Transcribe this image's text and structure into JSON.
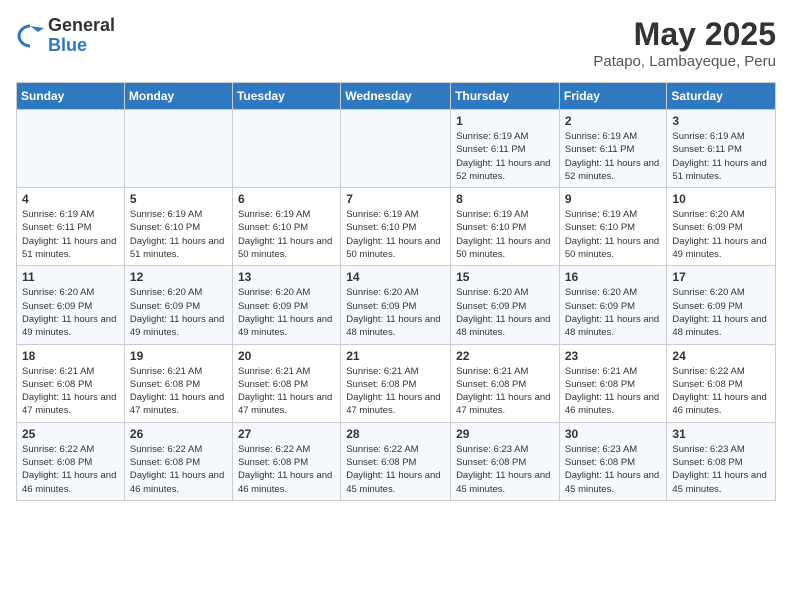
{
  "logo": {
    "general": "General",
    "blue": "Blue"
  },
  "title": "May 2025",
  "subtitle": "Patapo, Lambayeque, Peru",
  "days_of_week": [
    "Sunday",
    "Monday",
    "Tuesday",
    "Wednesday",
    "Thursday",
    "Friday",
    "Saturday"
  ],
  "weeks": [
    [
      {
        "day": "",
        "info": ""
      },
      {
        "day": "",
        "info": ""
      },
      {
        "day": "",
        "info": ""
      },
      {
        "day": "",
        "info": ""
      },
      {
        "day": "1",
        "info": "Sunrise: 6:19 AM\nSunset: 6:11 PM\nDaylight: 11 hours\nand 52 minutes."
      },
      {
        "day": "2",
        "info": "Sunrise: 6:19 AM\nSunset: 6:11 PM\nDaylight: 11 hours\nand 52 minutes."
      },
      {
        "day": "3",
        "info": "Sunrise: 6:19 AM\nSunset: 6:11 PM\nDaylight: 11 hours\nand 51 minutes."
      }
    ],
    [
      {
        "day": "4",
        "info": "Sunrise: 6:19 AM\nSunset: 6:11 PM\nDaylight: 11 hours\nand 51 minutes."
      },
      {
        "day": "5",
        "info": "Sunrise: 6:19 AM\nSunset: 6:10 PM\nDaylight: 11 hours\nand 51 minutes."
      },
      {
        "day": "6",
        "info": "Sunrise: 6:19 AM\nSunset: 6:10 PM\nDaylight: 11 hours\nand 50 minutes."
      },
      {
        "day": "7",
        "info": "Sunrise: 6:19 AM\nSunset: 6:10 PM\nDaylight: 11 hours\nand 50 minutes."
      },
      {
        "day": "8",
        "info": "Sunrise: 6:19 AM\nSunset: 6:10 PM\nDaylight: 11 hours\nand 50 minutes."
      },
      {
        "day": "9",
        "info": "Sunrise: 6:19 AM\nSunset: 6:10 PM\nDaylight: 11 hours\nand 50 minutes."
      },
      {
        "day": "10",
        "info": "Sunrise: 6:20 AM\nSunset: 6:09 PM\nDaylight: 11 hours\nand 49 minutes."
      }
    ],
    [
      {
        "day": "11",
        "info": "Sunrise: 6:20 AM\nSunset: 6:09 PM\nDaylight: 11 hours\nand 49 minutes."
      },
      {
        "day": "12",
        "info": "Sunrise: 6:20 AM\nSunset: 6:09 PM\nDaylight: 11 hours\nand 49 minutes."
      },
      {
        "day": "13",
        "info": "Sunrise: 6:20 AM\nSunset: 6:09 PM\nDaylight: 11 hours\nand 49 minutes."
      },
      {
        "day": "14",
        "info": "Sunrise: 6:20 AM\nSunset: 6:09 PM\nDaylight: 11 hours\nand 48 minutes."
      },
      {
        "day": "15",
        "info": "Sunrise: 6:20 AM\nSunset: 6:09 PM\nDaylight: 11 hours\nand 48 minutes."
      },
      {
        "day": "16",
        "info": "Sunrise: 6:20 AM\nSunset: 6:09 PM\nDaylight: 11 hours\nand 48 minutes."
      },
      {
        "day": "17",
        "info": "Sunrise: 6:20 AM\nSunset: 6:09 PM\nDaylight: 11 hours\nand 48 minutes."
      }
    ],
    [
      {
        "day": "18",
        "info": "Sunrise: 6:21 AM\nSunset: 6:08 PM\nDaylight: 11 hours\nand 47 minutes."
      },
      {
        "day": "19",
        "info": "Sunrise: 6:21 AM\nSunset: 6:08 PM\nDaylight: 11 hours\nand 47 minutes."
      },
      {
        "day": "20",
        "info": "Sunrise: 6:21 AM\nSunset: 6:08 PM\nDaylight: 11 hours\nand 47 minutes."
      },
      {
        "day": "21",
        "info": "Sunrise: 6:21 AM\nSunset: 6:08 PM\nDaylight: 11 hours\nand 47 minutes."
      },
      {
        "day": "22",
        "info": "Sunrise: 6:21 AM\nSunset: 6:08 PM\nDaylight: 11 hours\nand 47 minutes."
      },
      {
        "day": "23",
        "info": "Sunrise: 6:21 AM\nSunset: 6:08 PM\nDaylight: 11 hours\nand 46 minutes."
      },
      {
        "day": "24",
        "info": "Sunrise: 6:22 AM\nSunset: 6:08 PM\nDaylight: 11 hours\nand 46 minutes."
      }
    ],
    [
      {
        "day": "25",
        "info": "Sunrise: 6:22 AM\nSunset: 6:08 PM\nDaylight: 11 hours\nand 46 minutes."
      },
      {
        "day": "26",
        "info": "Sunrise: 6:22 AM\nSunset: 6:08 PM\nDaylight: 11 hours\nand 46 minutes."
      },
      {
        "day": "27",
        "info": "Sunrise: 6:22 AM\nSunset: 6:08 PM\nDaylight: 11 hours\nand 46 minutes."
      },
      {
        "day": "28",
        "info": "Sunrise: 6:22 AM\nSunset: 6:08 PM\nDaylight: 11 hours\nand 45 minutes."
      },
      {
        "day": "29",
        "info": "Sunrise: 6:23 AM\nSunset: 6:08 PM\nDaylight: 11 hours\nand 45 minutes."
      },
      {
        "day": "30",
        "info": "Sunrise: 6:23 AM\nSunset: 6:08 PM\nDaylight: 11 hours\nand 45 minutes."
      },
      {
        "day": "31",
        "info": "Sunrise: 6:23 AM\nSunset: 6:08 PM\nDaylight: 11 hours\nand 45 minutes."
      }
    ]
  ]
}
